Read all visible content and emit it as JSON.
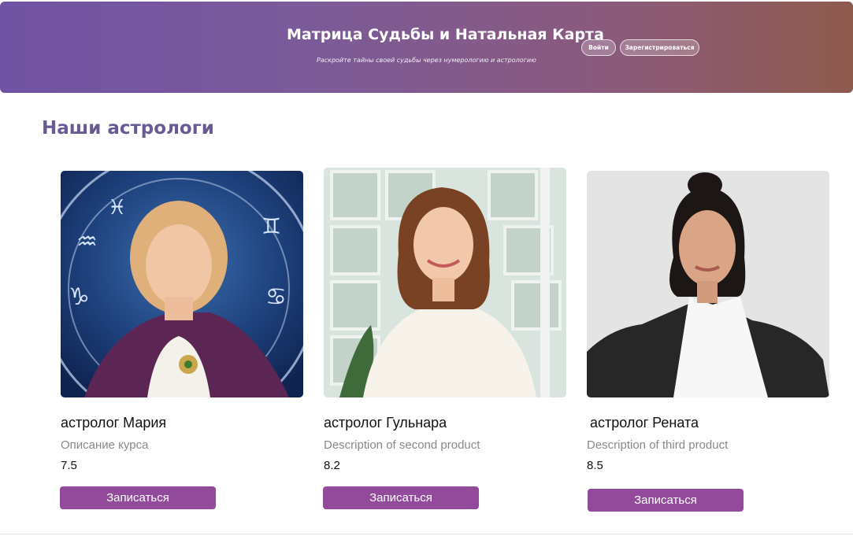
{
  "header": {
    "title": "Матрица Судьбы и Натальная Карта",
    "subtitle": "Раскройте тайны своей судьбы через нумерологию и астрологию",
    "login_label": "Войти",
    "register_label": "Зарегистрироваться"
  },
  "section": {
    "title": "Наши астрологи"
  },
  "astrologers": [
    {
      "name": "астролог Мария",
      "description": "Описание курса",
      "rating": "7.5",
      "button_label": "Записаться",
      "photo_icon": "astrologer-maria-photo"
    },
    {
      "name": "астролог Гульнара",
      "description": "Description of second product",
      "rating": "8.2",
      "button_label": "Записаться",
      "photo_icon": "astrologer-gulnara-photo"
    },
    {
      "name": "астролог Рената",
      "description": "Description of third product",
      "rating": "8.5",
      "button_label": "Записаться",
      "photo_icon": "astrologer-renata-photo"
    }
  ],
  "colors": {
    "header_gradient_start": "#7052a3",
    "header_gradient_end": "#8e5a4c",
    "section_title": "#6a5a94",
    "enroll_button": "#924a9b"
  }
}
